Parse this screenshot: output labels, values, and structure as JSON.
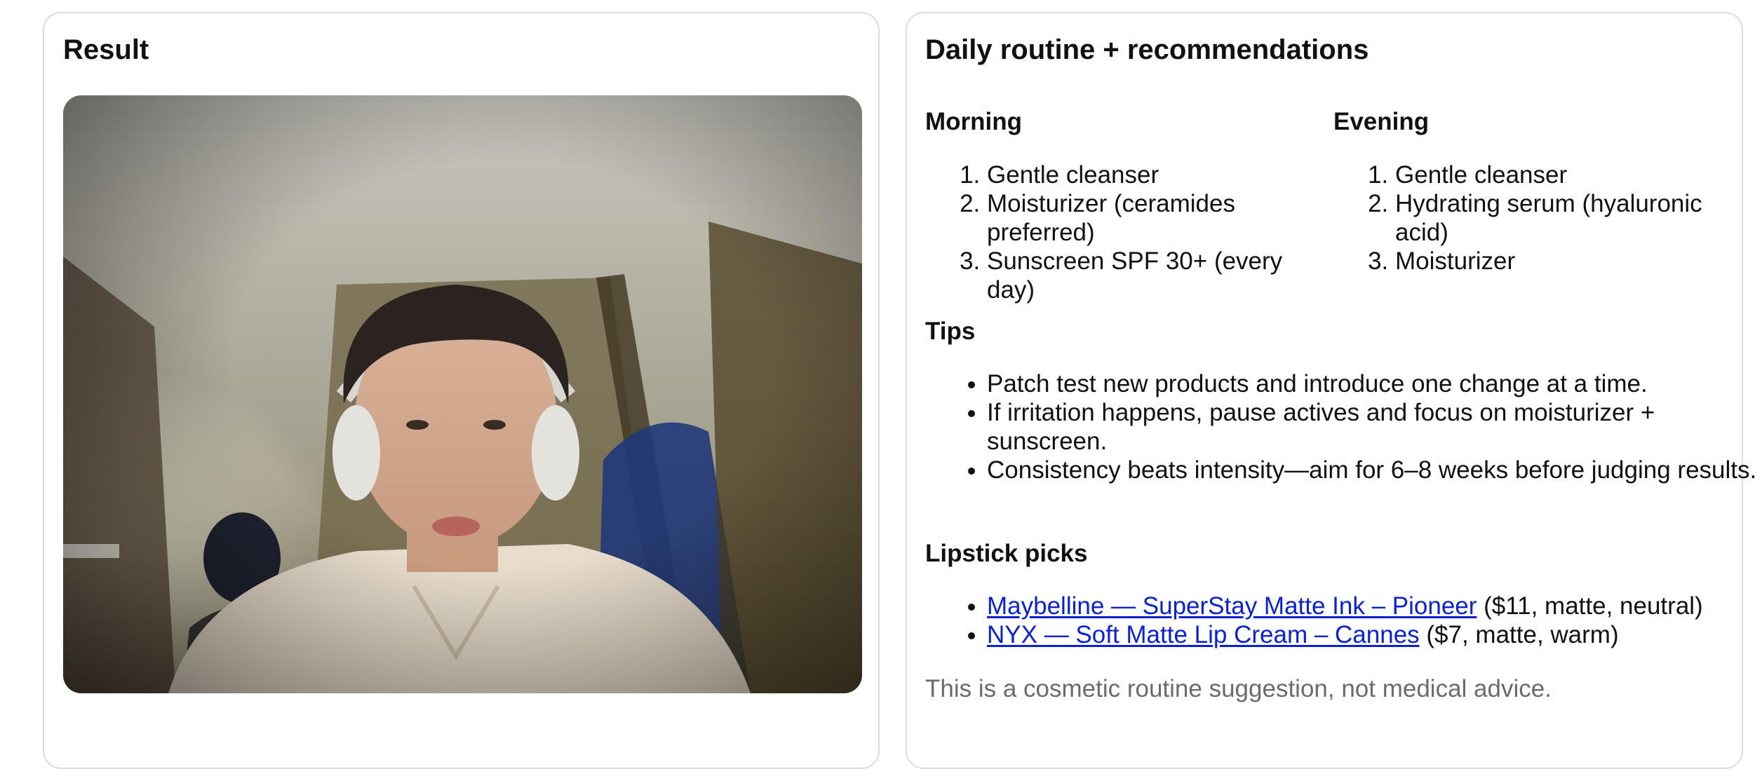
{
  "result_panel": {
    "title": "Result"
  },
  "routine_panel": {
    "title": "Daily routine + recommendations",
    "morning": {
      "heading": "Morning",
      "steps": [
        "Gentle cleanser",
        "Moisturizer (ceramides preferred)",
        "Sunscreen SPF 30+ (every day)"
      ]
    },
    "evening": {
      "heading": "Evening",
      "steps": [
        "Gentle cleanser",
        "Hydrating serum (hyaluronic acid)",
        "Moisturizer"
      ]
    },
    "tips": {
      "heading": "Tips",
      "items": [
        "Patch test new products and introduce one change at a time.",
        "If irritation happens, pause actives and focus on moisturizer + sunscreen.",
        "Consistency beats intensity—aim for 6–8 weeks before judging results."
      ]
    },
    "lipstick": {
      "heading": "Lipstick picks",
      "items": [
        {
          "link_text": "Maybelline — SuperStay Matte Ink – Pioneer",
          "details": "($11, matte, neutral)"
        },
        {
          "link_text": "NYX — Soft Matte Lip Cream – Cannes",
          "details": "($7, matte, warm)"
        }
      ]
    },
    "disclaimer": "This is a cosmetic routine suggestion, not medical advice."
  },
  "colors": {
    "link": "#0b22cc",
    "muted_text": "#6b6b6b",
    "card_border": "#dcdcdc"
  }
}
